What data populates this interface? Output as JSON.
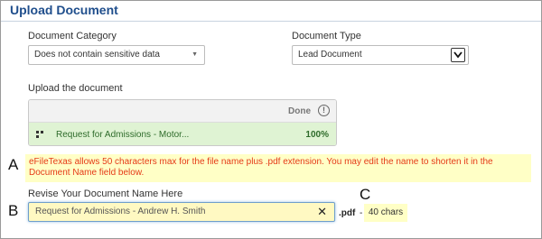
{
  "panel": {
    "title": "Upload Document"
  },
  "category": {
    "label": "Document Category",
    "selected": "Does not contain sensitive data"
  },
  "doc_type": {
    "label": "Document Type",
    "selected": "Lead Document"
  },
  "upload": {
    "label": "Upload the document",
    "done_header": "Done",
    "info_glyph": "!",
    "file": {
      "name": "Request for Admissions - Motor...",
      "progress_text": "100%",
      "progress": 1.0
    }
  },
  "warning": {
    "text": "eFileTexas allows 50 characters max for the file name plus .pdf extension. You may edit the name to shorten it in the Document Name field below."
  },
  "rename": {
    "label": "Revise Your Document Name Here",
    "value": "Request for Admissions - Andrew H. Smith",
    "clear_glyph": "✕",
    "extension": ".pdf",
    "dash": "-",
    "char_count": "40 chars"
  },
  "markers": {
    "a": "A",
    "b": "B",
    "c": "C"
  },
  "colors": {
    "title": "#1f4e8c",
    "warning_text": "#e53a17",
    "highlight": "#ffffc6",
    "success_bg": "#dff3d3",
    "success_text": "#2e6b2a"
  }
}
